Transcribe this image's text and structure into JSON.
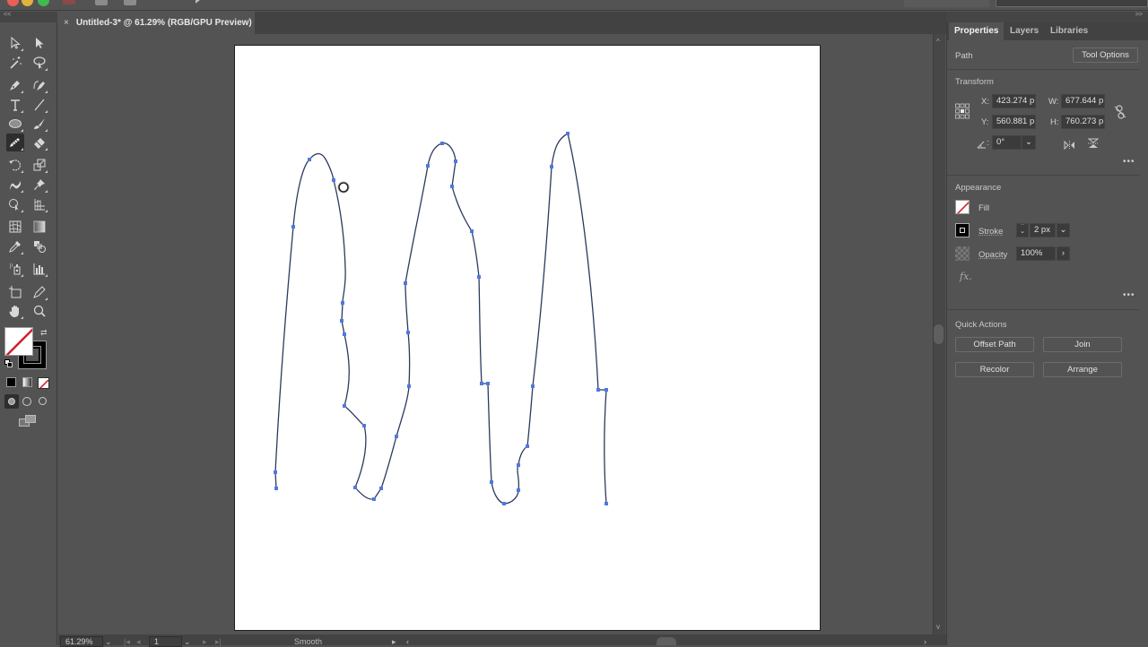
{
  "window": {
    "document_tab": {
      "close_glyph": "×",
      "title": "Untitled-3* @ 61.29% (RGB/GPU Preview)"
    },
    "panel_collapse_glyph": "<<",
    "panel_expand_glyph": ">>"
  },
  "toolbar": {
    "tools": [
      {
        "name": "selection-tool",
        "icon": "arrow-outline-icon"
      },
      {
        "name": "direct-selection-tool",
        "icon": "arrow-filled-icon"
      },
      {
        "name": "magic-wand-tool",
        "icon": "magic-wand-icon"
      },
      {
        "name": "lasso-tool",
        "icon": "lasso-icon"
      },
      {
        "name": "pen-tool",
        "icon": "pen-icon"
      },
      {
        "name": "curvature-tool",
        "icon": "curvature-pen-icon"
      },
      {
        "name": "type-tool",
        "icon": "type-icon",
        "glyph": "T"
      },
      {
        "name": "line-segment-tool",
        "icon": "line-icon"
      },
      {
        "name": "ellipse-tool",
        "icon": "ellipse-icon"
      },
      {
        "name": "paintbrush-tool",
        "icon": "brush-icon"
      },
      {
        "name": "pencil-tool",
        "icon": "pencil-icon",
        "active": true
      },
      {
        "name": "eraser-tool",
        "icon": "eraser-icon"
      },
      {
        "name": "rotate-tool",
        "icon": "rotate-icon"
      },
      {
        "name": "scale-tool",
        "icon": "scale-icon"
      },
      {
        "name": "warp-tool",
        "icon": "warp-icon"
      },
      {
        "name": "puppet-warp-tool",
        "icon": "pin-icon"
      },
      {
        "name": "shape-builder-tool",
        "icon": "shape-builder-icon"
      },
      {
        "name": "perspective-grid-tool",
        "icon": "perspective-grid-icon"
      },
      {
        "name": "mesh-tool",
        "icon": "mesh-icon"
      },
      {
        "name": "gradient-tool",
        "icon": "gradient-icon"
      },
      {
        "name": "eyedropper-tool",
        "icon": "eyedropper-icon"
      },
      {
        "name": "blend-tool",
        "icon": "blend-icon"
      },
      {
        "name": "symbol-sprayer-tool",
        "icon": "symbol-sprayer-icon"
      },
      {
        "name": "column-graph-tool",
        "icon": "bar-graph-icon"
      },
      {
        "name": "artboard-tool",
        "icon": "artboard-icon"
      },
      {
        "name": "slice-tool",
        "icon": "knife-icon"
      },
      {
        "name": "hand-tool",
        "icon": "hand-icon"
      },
      {
        "name": "zoom-tool",
        "icon": "magnifier-icon"
      }
    ],
    "fill_state": "none",
    "stroke_color": "#000000",
    "none_slash_color": "#d0202e"
  },
  "canvas": {
    "artboard_bg": "#ffffff",
    "path_color": "#2b3b5c",
    "anchor_color": "#4f78e0",
    "cursor": "pencil-smooth-circle"
  },
  "status_bar": {
    "zoom": "61.29%",
    "artboard_number": "1",
    "current_tool": "Smooth"
  },
  "properties_panel": {
    "tabs": [
      {
        "label": "Properties",
        "active": true
      },
      {
        "label": "Layers",
        "active": false
      },
      {
        "label": "Libraries",
        "active": false
      }
    ],
    "selection_type": "Path",
    "tool_options_label": "Tool Options",
    "transform": {
      "title": "Transform",
      "x_label": "X:",
      "x_value": "423.274 p",
      "y_label": "Y:",
      "y_value": "560.881 p",
      "w_label": "W:",
      "w_value": "677.644 p",
      "h_label": "H:",
      "h_value": "760.273 p",
      "angle_label": ":",
      "angle_value": "0°"
    },
    "appearance": {
      "title": "Appearance",
      "fill_label": "Fill",
      "stroke_label": "Stroke",
      "stroke_weight": "2 px",
      "opacity_label": "Opacity",
      "opacity_value": "100%",
      "fx_label": "fx."
    },
    "quick_actions": {
      "title": "Quick Actions",
      "buttons": [
        "Offset Path",
        "Join",
        "Recolor",
        "Arrange"
      ]
    },
    "more_glyph": "•••"
  }
}
